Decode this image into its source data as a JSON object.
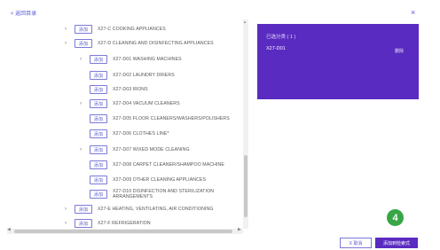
{
  "header": {
    "back_label": "< 返回目录",
    "close_icon": "×"
  },
  "tree": [
    {
      "chevron": true,
      "label": "X27-C COOKING APPLIANCES"
    },
    {
      "chevron": true,
      "label": "X27-D CLEANING AND DISINFECTING APPLIANCES"
    },
    {
      "chevron": true,
      "label": "X27-D01 WASHING MACHINES"
    },
    {
      "chevron": false,
      "label": "X27-D02 LAUNDRY DRIERS"
    },
    {
      "chevron": false,
      "label": "X27-D03 IRONS"
    },
    {
      "chevron": true,
      "label": "X27-D04 VACUUM CLEANERS"
    },
    {
      "chevron": false,
      "label": "X27-D05 FLOOR CLEANERS/WASHERS/POLISHERS"
    },
    {
      "chevron": false,
      "label": "X27-D06 CLOTHES LINE*"
    },
    {
      "chevron": true,
      "label": "X27-D07 WIXED MODE CLEANING"
    },
    {
      "chevron": false,
      "label": "X27-D08 CARPET CLEANER/SHAMPOO MACHINE"
    },
    {
      "chevron": false,
      "label": "X27-D09 OTHER CLEANING APPLIANCES"
    },
    {
      "chevron": false,
      "label": "X27-D10 DISINFECTION AND STERILIZATION",
      "label2": "ARRANGEMENTS"
    },
    {
      "chevron": true,
      "label": "X27-E HEATING, VENTILATING, AIR CONDITIONING"
    },
    {
      "chevron": true,
      "label": "X27-F REFRIGERATION"
    }
  ],
  "add_label": "添加",
  "selected_panel": {
    "title": "已选分类 ( 1 )",
    "code": "X27-D01",
    "delete_label": "删除"
  },
  "badge": "4",
  "footer": {
    "cancel_label": "X 取消",
    "ok_label": "添加到检索式"
  },
  "colors": {
    "accent": "#5a2bc0",
    "badge": "#37a645"
  }
}
